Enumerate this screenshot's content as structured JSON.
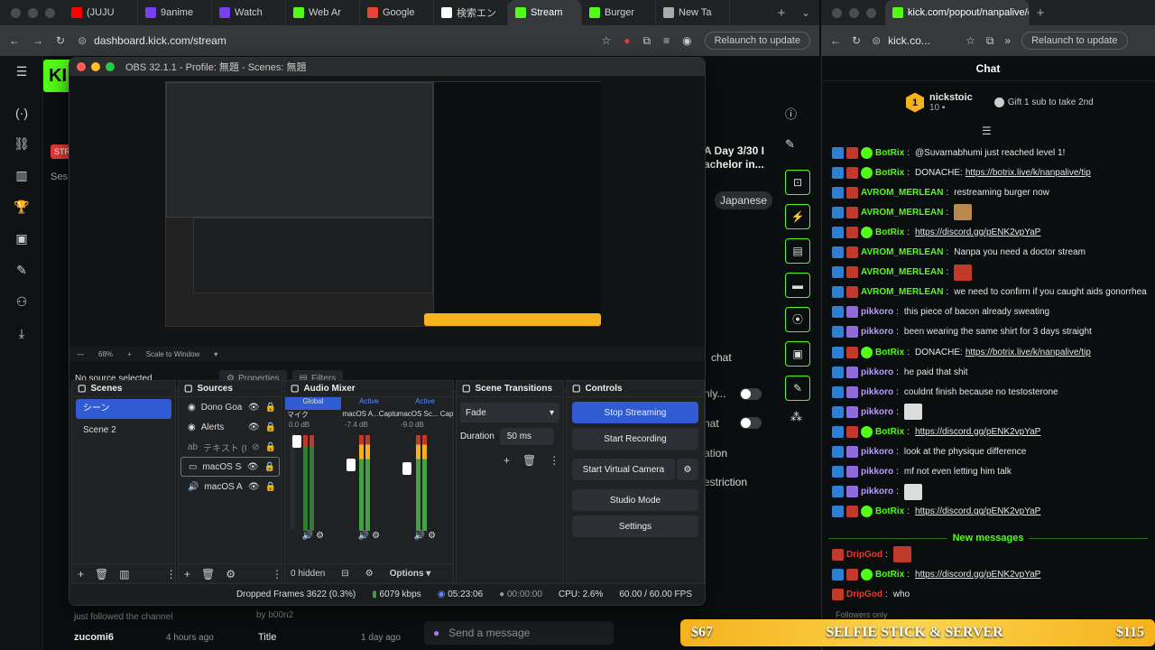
{
  "left_browser": {
    "tabs": [
      {
        "label": "(JUJU",
        "color": "#ff0000"
      },
      {
        "label": "9anime",
        "color": "#7a3ff2"
      },
      {
        "label": "Watch",
        "color": "#7a3ff2"
      },
      {
        "label": "Web Ar",
        "color": "#53fc18"
      },
      {
        "label": "Google",
        "color": "#ea4335"
      },
      {
        "label": "検索エン",
        "color": "#ffffff"
      },
      {
        "label": "Stream",
        "color": "#53fc18"
      },
      {
        "label": "Burger",
        "color": "#53fc18"
      },
      {
        "label": "New Ta",
        "color": "#aaaaaa"
      }
    ],
    "url": "dashboard.kick.com/stream",
    "relaunch": "Relaunch to update"
  },
  "kick_dashboard": {
    "stream_title_frag": "A Day 3/30 I",
    "stream_title_frag2": "achelor in...",
    "tag": "Japanese",
    "chat_rows": [
      "chat",
      "nly...",
      "nat",
      "ation",
      "estriction"
    ],
    "activity": [
      {
        "text": "just followed the channel"
      },
      {
        "user": "zucomi6",
        "time": "4 hours ago"
      }
    ],
    "event_by": "by b00n2",
    "event_title": "Title",
    "event_time": "1 day ago",
    "send_placeholder": "Send a message",
    "left_label": "Ses"
  },
  "obs": {
    "title": "OBS 32.1.1 - Profile: 無題 - Scenes: 無題",
    "zoom": "68%",
    "scale_label": "Scale to Window",
    "no_source": "No source selected",
    "properties": "Properties",
    "filters": "Filters",
    "scenes_title": "Scenes",
    "scenes": [
      "シーン",
      "Scene 2"
    ],
    "sources_title": "Sources",
    "sources": [
      "Dono Goal",
      "Alerts",
      "テキスト (Fr",
      "macOS Scre",
      "macOS Aud"
    ],
    "mixer_title": "Audio Mixer",
    "mixer": [
      {
        "tag": "Global",
        "name": "マイク",
        "db": "0.0 dB"
      },
      {
        "tag": "Active",
        "name": "macOS A...Capture",
        "db": "-7.4 dB"
      },
      {
        "tag": "Active",
        "name": "macOS Sc... Capt",
        "db": "-9.0 dB"
      }
    ],
    "hidden": "0 hidden",
    "options": "Options",
    "transitions_title": "Scene Transitions",
    "transition": "Fade",
    "duration_label": "Duration",
    "duration": "50 ms",
    "controls_title": "Controls",
    "controls": [
      "Stop Streaming",
      "Start Recording",
      "Start Virtual Camera",
      "Studio Mode",
      "Settings"
    ],
    "status": {
      "dropped": "Dropped Frames 3622 (0.3%)",
      "bitrate": "6079 kbps",
      "stream_time": "05:23:06",
      "rec_time": "00:00:00",
      "cpu": "CPU: 2.6%",
      "fps": "60.00 / 60.00 FPS"
    }
  },
  "right_browser": {
    "url": "kick.com/popout/nanpalive/c",
    "url_short": "kick.co...",
    "relaunch": "Relaunch to update",
    "chat_title": "Chat",
    "pinned_user": "nickstoic",
    "pinned_rank": "1",
    "pinned_count": "10",
    "gift_text": "Gift 1 sub to take 2nd",
    "messages": [
      {
        "user": "BotRix",
        "color": "#53fc18",
        "text": "@Suvarnabhumi just reached level 1!"
      },
      {
        "user": "BotRix",
        "color": "#53fc18",
        "link": "DONACHE: ",
        "url": "https://botrix.live/k/nanpalive/tip"
      },
      {
        "user": "AVROM_MERLEAN",
        "color": "#53fc18",
        "text": "restreaming burger now"
      },
      {
        "user": "AVROM_MERLEAN",
        "color": "#53fc18",
        "emote": "#b8894a"
      },
      {
        "user": "BotRix",
        "color": "#53fc18",
        "url": "https://discord.gg/pENK2vpYaP"
      },
      {
        "user": "AVROM_MERLEAN",
        "color": "#53fc18",
        "text": "Nanpa you need a doctor stream"
      },
      {
        "user": "AVROM_MERLEAN",
        "color": "#53fc18",
        "emote": "#c0392b"
      },
      {
        "user": "AVROM_MERLEAN",
        "color": "#53fc18",
        "text": "we need to confirm if you caught aids gonorrhea"
      },
      {
        "user": "pikkoro",
        "color": "#b99bff",
        "text": "this piece of bacon already sweating"
      },
      {
        "user": "pikkoro",
        "color": "#b99bff",
        "text": "been wearing the same shirt for 3 days straight"
      },
      {
        "user": "BotRix",
        "color": "#53fc18",
        "link": "DONACHE: ",
        "url": "https://botrix.live/k/nanpalive/tip"
      },
      {
        "user": "pikkoro",
        "color": "#b99bff",
        "text": "he paid that shit"
      },
      {
        "user": "pikkoro",
        "color": "#b99bff",
        "text": "couldnt finish because no testosterone"
      },
      {
        "user": "pikkoro",
        "color": "#b99bff",
        "emote": "#dddddd"
      },
      {
        "user": "BotRix",
        "color": "#53fc18",
        "url": "https://discord.gg/pENK2vpYaP"
      },
      {
        "user": "pikkoro",
        "color": "#b99bff",
        "text": "look at the physique difference"
      },
      {
        "user": "pikkoro",
        "color": "#b99bff",
        "text": "mf not even letting him talk"
      },
      {
        "user": "pikkoro",
        "color": "#b99bff",
        "emote": "#dddddd"
      },
      {
        "user": "BotRix",
        "color": "#53fc18",
        "url": "https://discord.gg/pENK2vpYaP"
      }
    ],
    "new_messages": "New messages",
    "new": [
      {
        "user": "DripGod",
        "color": "#e53935",
        "emote": "#c0392b"
      },
      {
        "user": "BotRix",
        "color": "#53fc18",
        "url": "https://discord.gg/pENK2vpYaP"
      },
      {
        "user": "DripGod",
        "color": "#e53935",
        "text": "who"
      }
    ],
    "followers_only": "Followers only"
  },
  "banner": {
    "left": "$67",
    "title": "SELFIE STICK & SERVER",
    "right": "$115"
  }
}
